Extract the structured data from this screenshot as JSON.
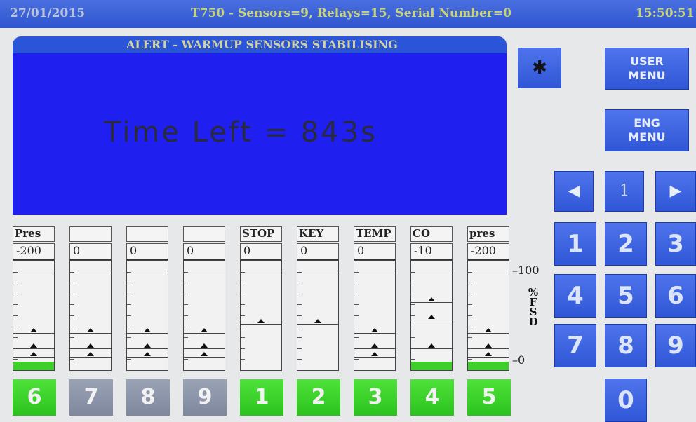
{
  "header": {
    "date": "27/01/2015",
    "title": "T750 - Sensors=9, Relays=15, Serial Number=0",
    "time": "15:50:51"
  },
  "alert": {
    "title": "ALERT - WARMUP SENSORS STABILISING",
    "message": "Time Left = 843s"
  },
  "buttons": {
    "bluetooth_icon": "bluetooth-icon",
    "bluetooth_glyph": "✱",
    "user_menu_line1": "USER",
    "user_menu_line2": "MENU",
    "eng_menu_line1": "ENG",
    "eng_menu_line2": "MENU",
    "page_number": "1",
    "prev_glyph": "◀",
    "next_glyph": "▶"
  },
  "keypad": [
    "1",
    "2",
    "3",
    "4",
    "5",
    "6",
    "7",
    "8",
    "9",
    "0"
  ],
  "scale": {
    "top": "100",
    "bottom": "0",
    "label_chars": [
      "%",
      "F",
      "S",
      "D"
    ]
  },
  "channels": [
    {
      "name": "Pres",
      "value": "-200",
      "button": "6",
      "active": true,
      "fill": 0.08,
      "markers": [
        0.34,
        0.2,
        0.12
      ]
    },
    {
      "name": "",
      "value": "0",
      "button": "7",
      "active": false,
      "fill": 0,
      "markers": [
        0.34,
        0.2,
        0.12
      ]
    },
    {
      "name": "",
      "value": "0",
      "button": "8",
      "active": false,
      "fill": 0,
      "markers": [
        0.34,
        0.2,
        0.12
      ]
    },
    {
      "name": "",
      "value": "0",
      "button": "9",
      "active": false,
      "fill": 0,
      "markers": [
        0.34,
        0.2,
        0.12
      ]
    },
    {
      "name": "STOP",
      "value": "0",
      "button": "1",
      "active": true,
      "fill": 0,
      "markers": [
        0.42
      ]
    },
    {
      "name": "KEY",
      "value": "0",
      "button": "2",
      "active": true,
      "fill": 0,
      "markers": [
        0.42
      ]
    },
    {
      "name": "TEMP",
      "value": "0",
      "button": "3",
      "active": true,
      "fill": 0,
      "markers": [
        0.34,
        0.2,
        0.12
      ]
    },
    {
      "name": "CO",
      "value": "-10",
      "button": "4",
      "active": true,
      "fill": 0.08,
      "markers": [
        0.62,
        0.46,
        0.2
      ]
    },
    {
      "name": "pres",
      "value": "-200",
      "button": "5",
      "active": true,
      "fill": 0.08,
      "markers": [
        0.34,
        0.2,
        0.12
      ]
    }
  ],
  "colors": {
    "header_bg": "#2f55d0",
    "alert_bg": "#1f1ff0",
    "active_green": "#3fcf2c",
    "inactive_grey": "#8790a4"
  }
}
